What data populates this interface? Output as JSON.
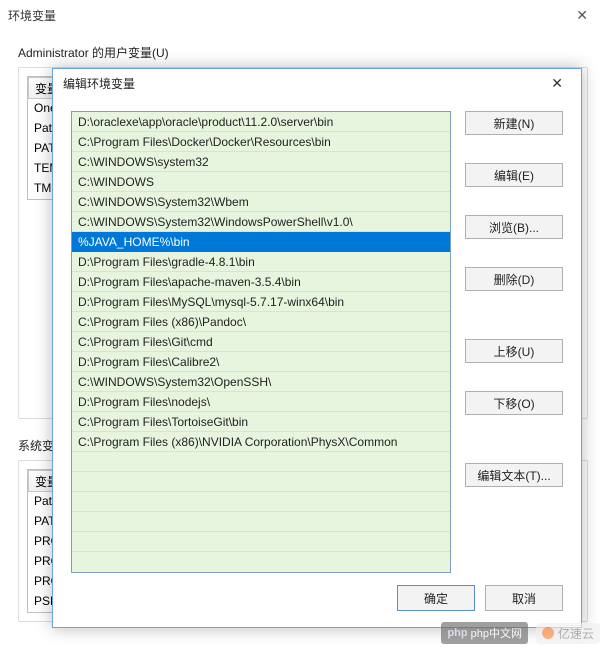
{
  "parent": {
    "title": "环境变量",
    "user_vars_label": "Administrator 的用户变量(U)",
    "system_vars_label": "系统变量(S)",
    "col_var": "变量",
    "user_rows": [
      "One",
      "Path",
      "PAT",
      "TEM",
      "TMI"
    ],
    "sys_rows": [
      "Path",
      "PAT",
      "PRO",
      "PRO",
      "PRO",
      "PSN"
    ]
  },
  "dialog": {
    "title": "编辑环境变量",
    "items": [
      "D:\\oraclexe\\app\\oracle\\product\\11.2.0\\server\\bin",
      "C:\\Program Files\\Docker\\Docker\\Resources\\bin",
      "C:\\WINDOWS\\system32",
      "C:\\WINDOWS",
      "C:\\WINDOWS\\System32\\Wbem",
      "C:\\WINDOWS\\System32\\WindowsPowerShell\\v1.0\\",
      "%JAVA_HOME%\\bin",
      "D:\\Program Files\\gradle-4.8.1\\bin",
      "D:\\Program Files\\apache-maven-3.5.4\\bin",
      "D:\\Program Files\\MySQL\\mysql-5.7.17-winx64\\bin",
      "C:\\Program Files (x86)\\Pandoc\\",
      "C:\\Program Files\\Git\\cmd",
      "D:\\Program Files\\Calibre2\\",
      "C:\\WINDOWS\\System32\\OpenSSH\\",
      "D:\\Program Files\\nodejs\\",
      "C:\\Program Files\\TortoiseGit\\bin",
      "C:\\Program Files (x86)\\NVIDIA Corporation\\PhysX\\Common"
    ],
    "selected_index": 6,
    "buttons": {
      "new": "新建(N)",
      "edit": "编辑(E)",
      "browse": "浏览(B)...",
      "delete": "删除(D)",
      "move_up": "上移(U)",
      "move_down": "下移(O)",
      "edit_text": "编辑文本(T)...",
      "ok": "确定",
      "cancel": "取消"
    }
  },
  "watermark": {
    "php": "php中文网",
    "yisu": "亿速云"
  }
}
